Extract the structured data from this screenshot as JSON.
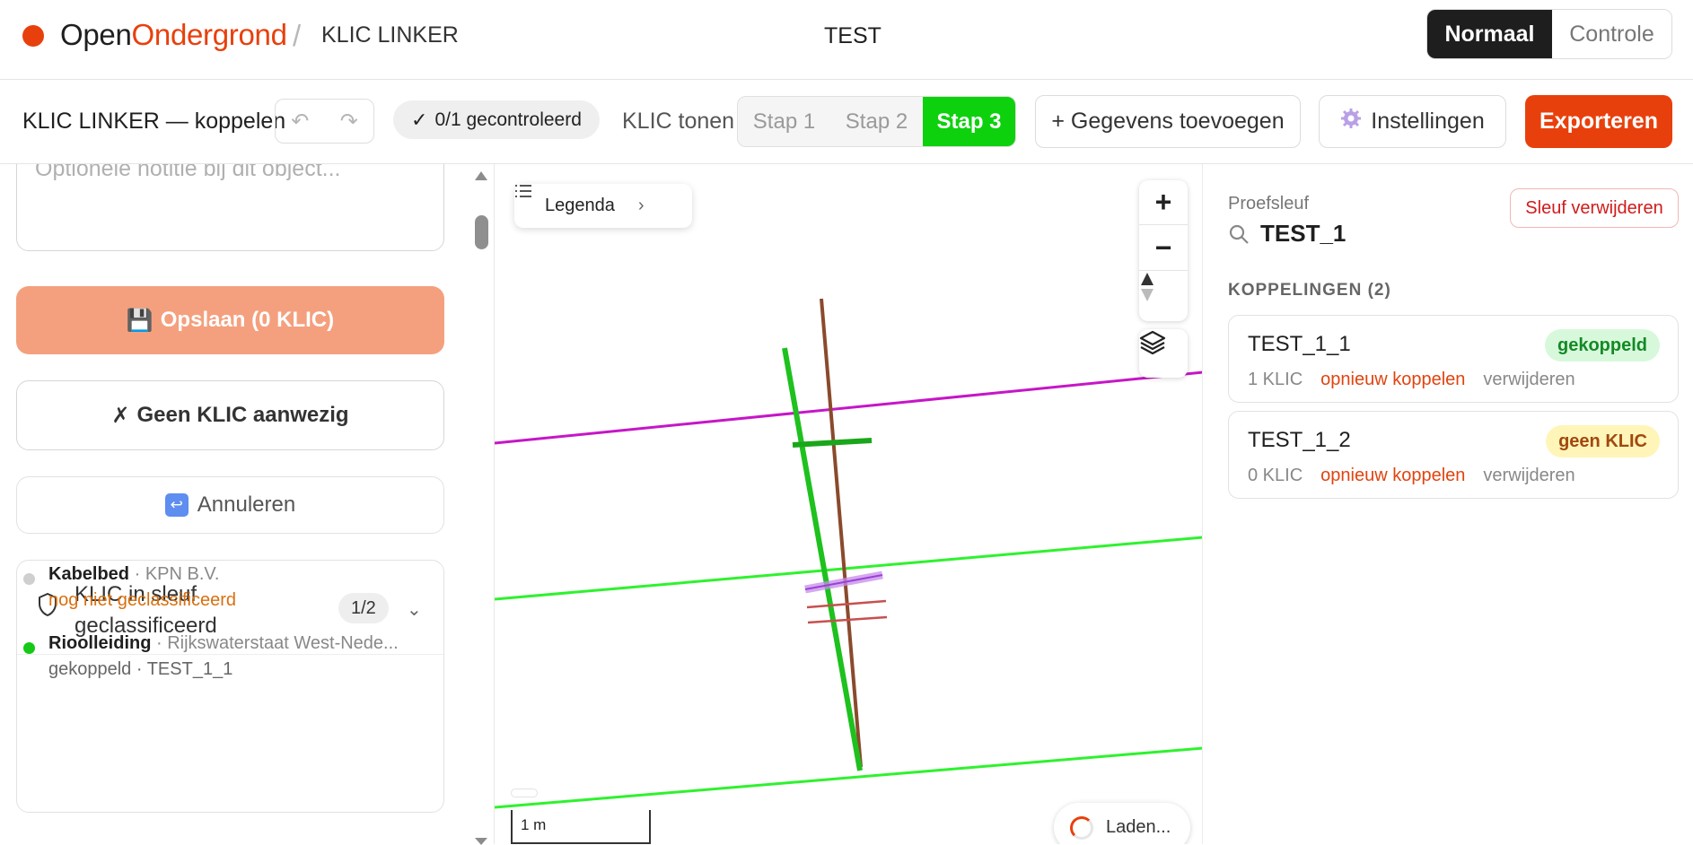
{
  "header": {
    "brand_part1": "Open",
    "brand_part2": "Ondergrond",
    "crumb_separator": "/",
    "app_name": "KLIC LINKER",
    "project": "TEST",
    "modes": {
      "active": "Normaal",
      "other": "Controle"
    },
    "brand_color": "#e8400c"
  },
  "toolbar": {
    "title": "KLIC LINKER — koppelen",
    "undo_icon": "undo-icon",
    "redo_icon": "redo-icon",
    "checked": "0/1 gecontroleerd",
    "klic_label": "KLIC tonen",
    "steps": [
      "Stap 1",
      "Stap 2",
      "Stap 3"
    ],
    "active_step": "Stap 3",
    "add_data": "+ Gegevens toevoegen",
    "settings": "Instellingen",
    "export": "Exporteren"
  },
  "left": {
    "note_placeholder": "Optionele notitie bij dit object...",
    "save_label": "Opslaan (0 KLIC)",
    "no_klic_label": "Geen KLIC aanwezig",
    "cancel_label": "Annuleren",
    "klic_section": {
      "title": "KLIC in sleuf geclassificeerd",
      "count": "1/2",
      "items": [
        {
          "name": "Kabelbed",
          "owner": "KPN B.V.",
          "status": "nog niet geclassificeerd",
          "dot_color": "#cfcfcf",
          "status_color": "#d8700f"
        },
        {
          "name": "Rioolleiding",
          "owner": "Rijkswaterstaat West-Nede...",
          "status": "gekoppeld · TEST_1_1",
          "dot_color": "#16c916",
          "status_color": "#666666"
        }
      ]
    }
  },
  "map": {
    "legend_label": "Legenda",
    "zoom_in": "+",
    "zoom_out": "−",
    "scale_label": "1 m",
    "loading_label": "Laden..."
  },
  "right": {
    "label": "Proefsleuf",
    "name": "TEST_1",
    "delete_label": "Sleuf verwijderen",
    "section_title": "KOPPELINGEN (2)",
    "links": [
      {
        "name": "TEST_1_1",
        "badge": "gekoppeld",
        "count": "1 KLIC",
        "relink": "opnieuw koppelen",
        "remove": "verwijderen"
      },
      {
        "name": "TEST_1_2",
        "badge": "geen KLIC",
        "count": "0 KLIC",
        "relink": "opnieuw koppelen",
        "remove": "verwijderen"
      }
    ]
  }
}
